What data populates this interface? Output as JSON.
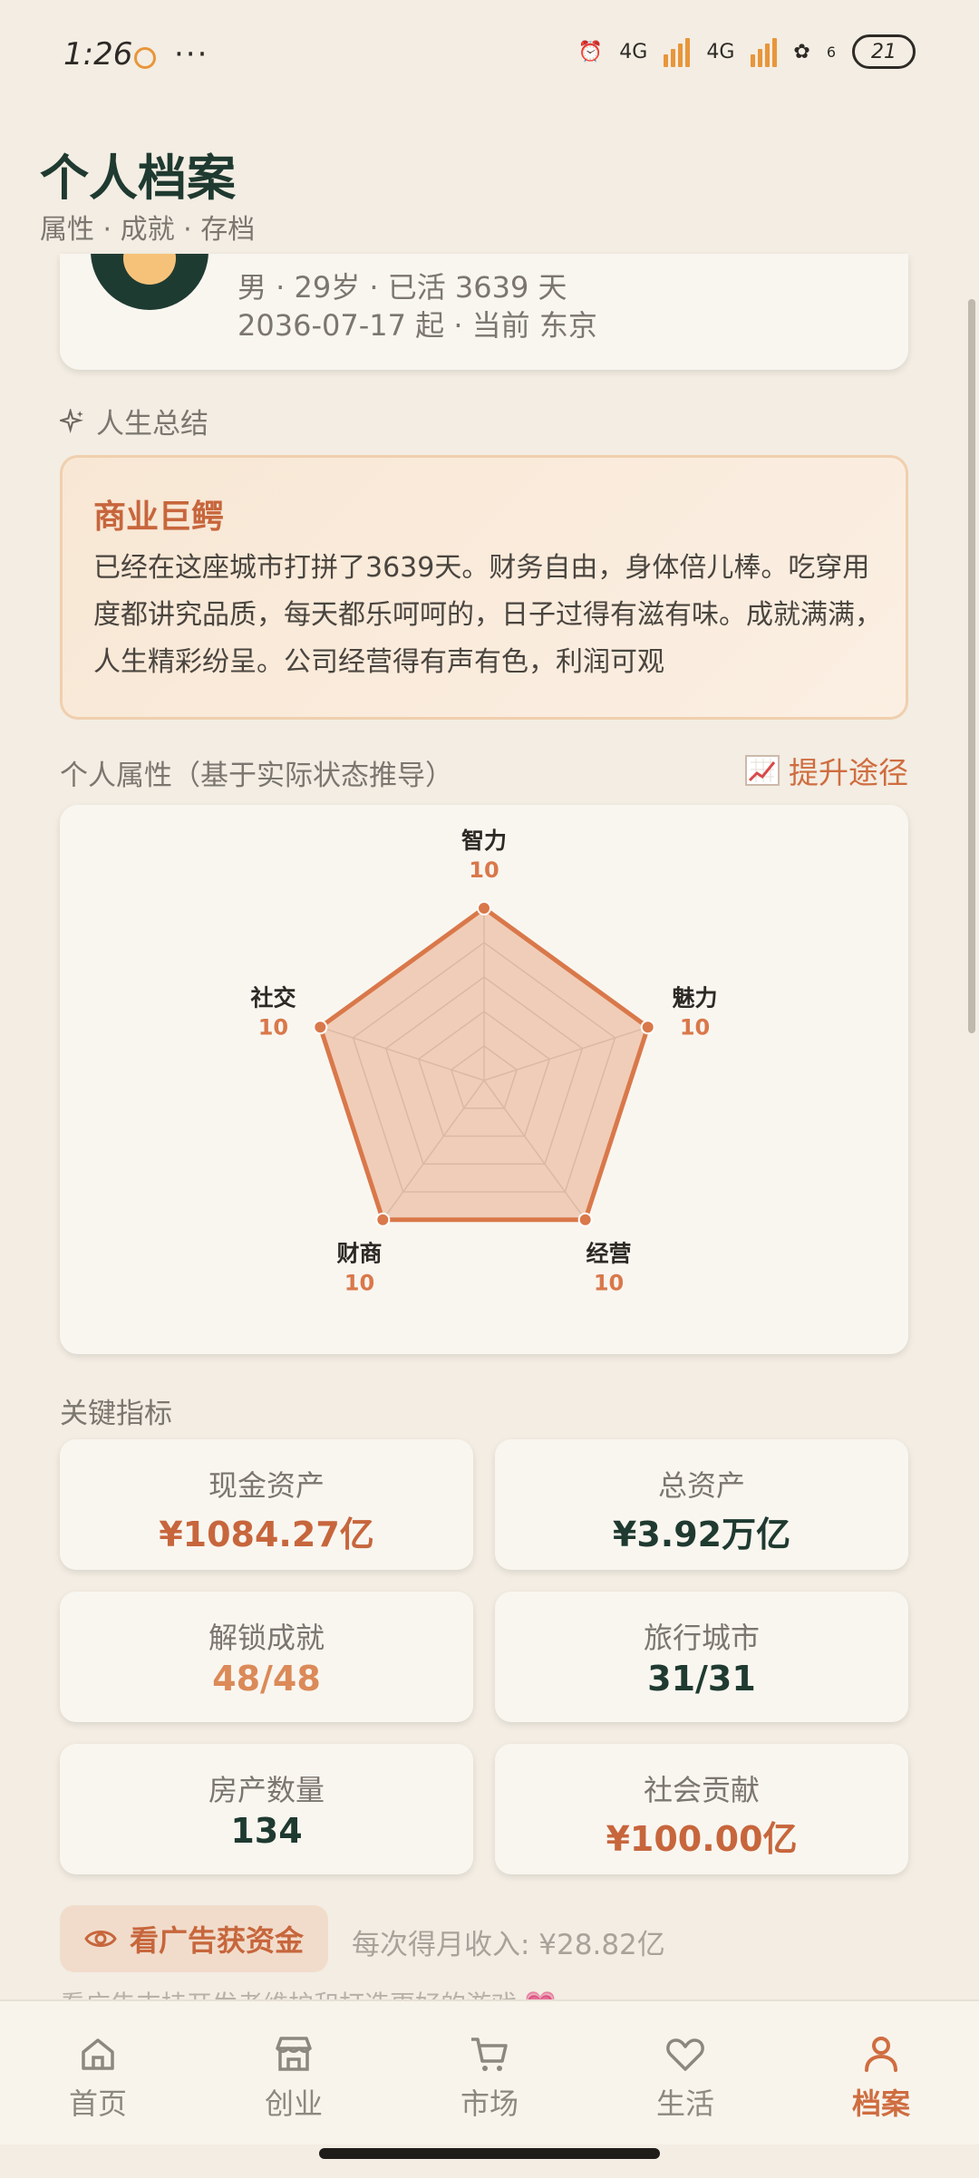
{
  "status": {
    "time": "1:26",
    "dots": "···",
    "battery": "21",
    "net1": "4G",
    "net2": "4G",
    "wifi_badge": "6"
  },
  "header": {
    "title": "个人档案",
    "subtitle": "属性 · 成就 · 存档"
  },
  "profile": {
    "line1": "男 · 29岁 · 已活 3639 天",
    "line2": "2036-07-17 起 · 当前 东京"
  },
  "summary": {
    "label": "人生总结",
    "title": "商业巨鳄",
    "text": "已经在这座城市打拼了3639天。财务自由，身体倍儿棒。吃穿用度都讲究品质，每天都乐呵呵的，日子过得有滋有味。成就满满，人生精彩纷呈。公司经营得有声有色，利润可观"
  },
  "attributes": {
    "label": "个人属性（基于实际状态推导）",
    "link": "提升途径"
  },
  "chart_data": {
    "type": "radar",
    "categories": [
      "智力",
      "魅力",
      "经营",
      "财商",
      "社交"
    ],
    "values": [
      10,
      10,
      10,
      10,
      10
    ],
    "max": 10,
    "levels": 5,
    "fill": "#e9b393",
    "stroke": "#d9784a"
  },
  "metrics": {
    "label": "关键指标",
    "items": [
      {
        "label": "现金资产",
        "value": "¥1084.27亿",
        "color": "orange"
      },
      {
        "label": "总资产",
        "value": "¥3.92万亿",
        "color": "green"
      },
      {
        "label": "解锁成就",
        "value": "48/48",
        "color": "light"
      },
      {
        "label": "旅行城市",
        "value": "31/31",
        "color": "green"
      },
      {
        "label": "房产数量",
        "value": "134",
        "color": "green"
      },
      {
        "label": "社会贡献",
        "value": "¥100.00亿",
        "color": "orange"
      }
    ]
  },
  "ad": {
    "button": "看广告获资金",
    "note": "每次得月收入: ¥28.82亿",
    "sub": "看广告支持开发者维护和打造更好的游戏 💗"
  },
  "nav": {
    "items": [
      {
        "label": "首页",
        "icon": "home-icon"
      },
      {
        "label": "创业",
        "icon": "store-icon"
      },
      {
        "label": "市场",
        "icon": "cart-icon"
      },
      {
        "label": "生活",
        "icon": "heart-icon"
      },
      {
        "label": "档案",
        "icon": "person-icon"
      }
    ],
    "active": "档案"
  }
}
